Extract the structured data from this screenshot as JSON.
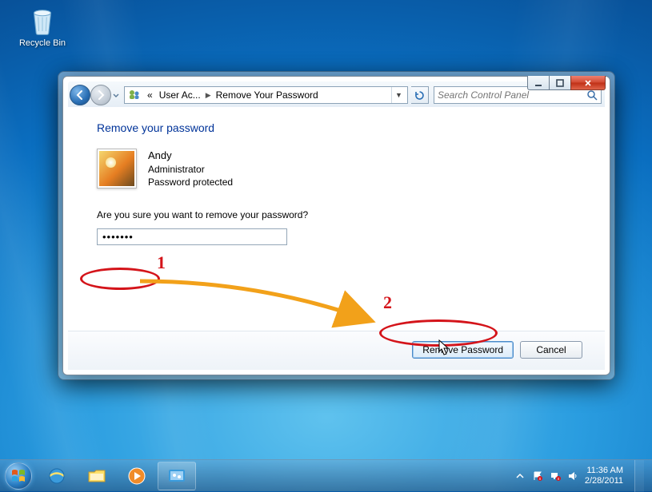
{
  "desktop": {
    "recycle_bin": "Recycle Bin"
  },
  "window": {
    "caption": {
      "min": "",
      "max": "",
      "close": ""
    },
    "breadcrumb": {
      "root_glyph": "«",
      "seg1": "User Ac...",
      "seg2": "Remove Your Password"
    },
    "search_placeholder": "Search Control Panel",
    "title": "Remove your password",
    "user": {
      "name": "Andy",
      "role": "Administrator",
      "status": "Password protected"
    },
    "prompt": "Are you sure you want to remove your password?",
    "password_value": "•••••••",
    "buttons": {
      "primary": "Remove Password",
      "cancel": "Cancel"
    }
  },
  "annotations": {
    "one": "1",
    "two": "2"
  },
  "taskbar": {
    "tray": {
      "time": "11:36 AM",
      "date": "2/28/2011"
    }
  }
}
